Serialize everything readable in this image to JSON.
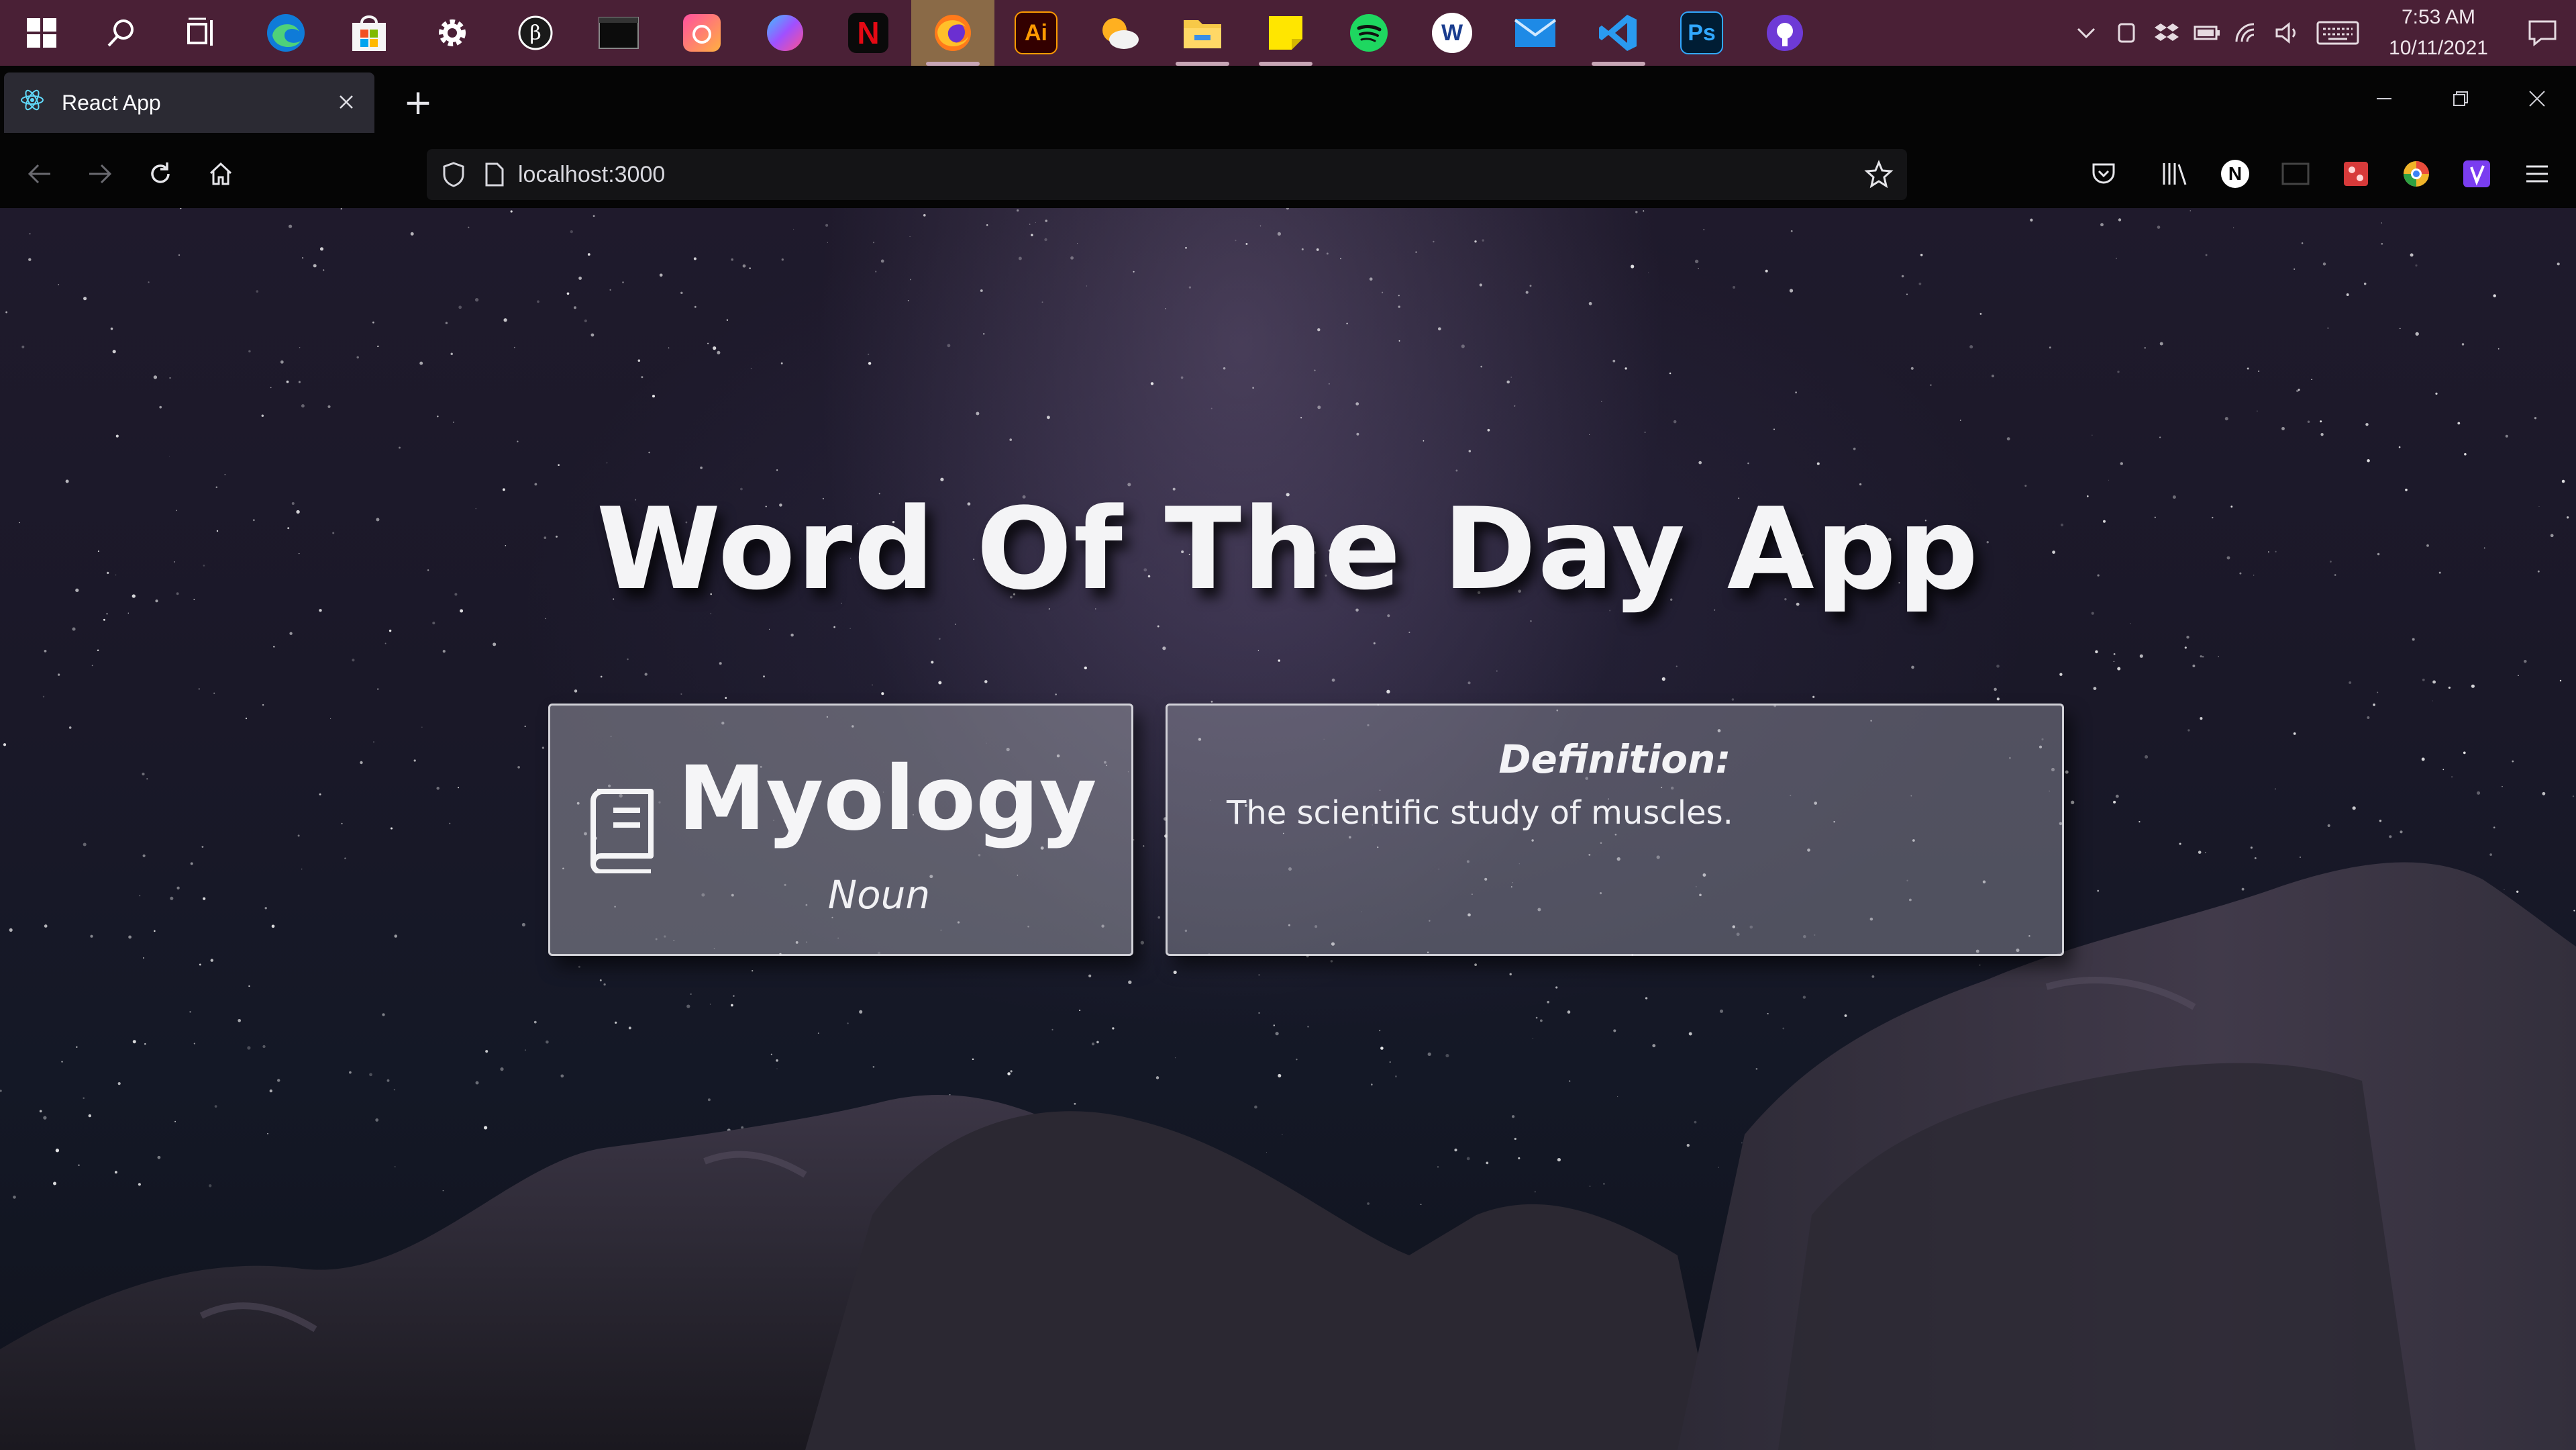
{
  "taskbar": {
    "icons": [
      {
        "name": "windows-start-icon"
      },
      {
        "name": "search-icon"
      },
      {
        "name": "task-view-icon"
      },
      {
        "name": "edge-icon"
      },
      {
        "name": "microsoft-store-icon"
      },
      {
        "name": "settings-gear-icon"
      },
      {
        "name": "beta-app-icon"
      },
      {
        "name": "terminal-icon"
      },
      {
        "name": "creative-cloud-icon"
      },
      {
        "name": "color-wheel-icon"
      },
      {
        "name": "netflix-icon",
        "glyph": "N"
      },
      {
        "name": "firefox-icon"
      },
      {
        "name": "illustrator-icon",
        "glyph": "Ai"
      },
      {
        "name": "weather-icon"
      },
      {
        "name": "file-explorer-icon"
      },
      {
        "name": "sticky-notes-icon"
      },
      {
        "name": "spotify-icon"
      },
      {
        "name": "app-w-icon",
        "glyph": "W"
      },
      {
        "name": "mail-icon"
      },
      {
        "name": "vscode-icon"
      },
      {
        "name": "photoshop-icon",
        "glyph": "Ps"
      },
      {
        "name": "github-icon"
      }
    ],
    "clock": {
      "time": "7:53 AM",
      "date": "10/11/2021"
    }
  },
  "browser": {
    "tab_title": "React App",
    "new_tab_symbol": "+",
    "url": "localhost:3000",
    "extension_badge_letter": "N"
  },
  "app": {
    "title": "Word Of The Day App",
    "word": "Myology",
    "part_of_speech": "Noun",
    "definition_label": "Definition:",
    "definition": "The scientific study of muscles."
  },
  "colors": {
    "taskbar_bg": "#4a2036",
    "active_taskbar_item": "#8a6a47",
    "browser_chrome": "#050505",
    "tab_bg": "#2b2a33",
    "card_bg": "#9696a0"
  }
}
